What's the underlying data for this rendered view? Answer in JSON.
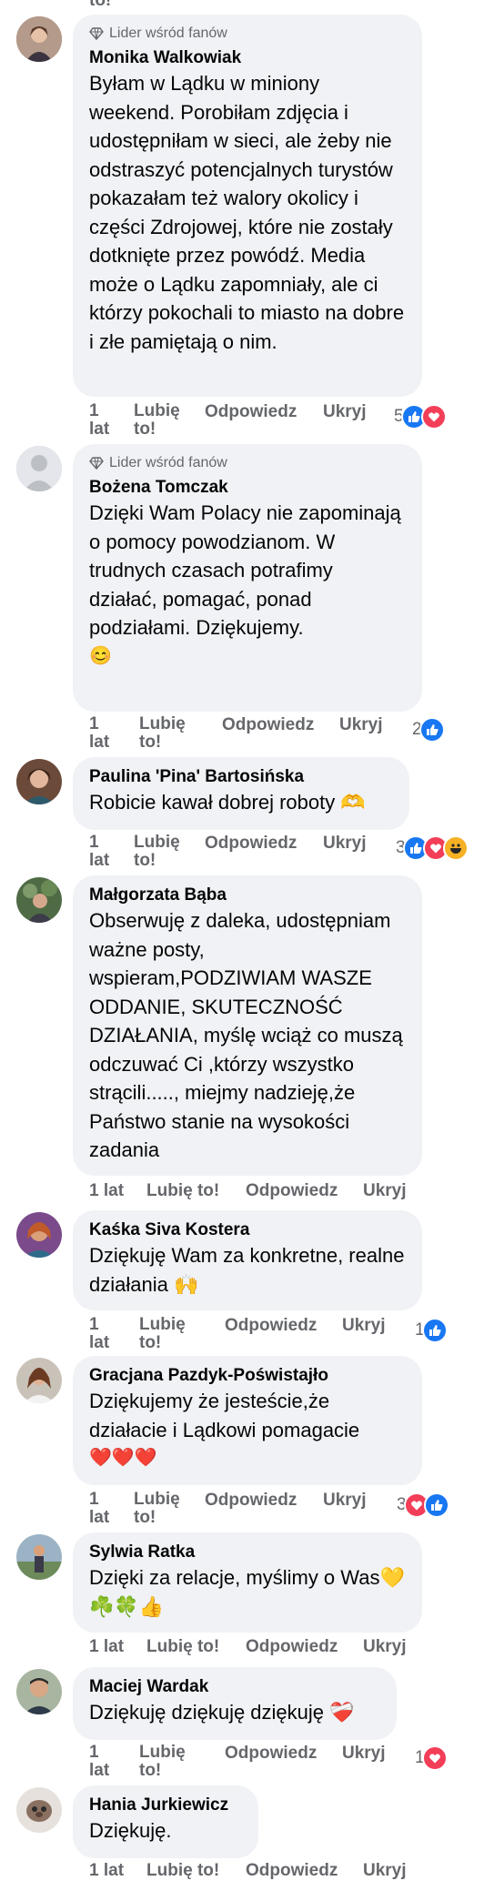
{
  "top_fragment": "to!",
  "comments": [
    {
      "badge": "Lider wśród fanów",
      "author": "Monika Walkowiak",
      "text": "Byłam w Lądku w miniony weekend. Porobiłam zdjęcia i udostępniłam w sieci, ale żeby nie odstraszyć potencjalnych turystów pokazałam też walory okolicy i części Zdrojowej, które nie zostały dotknięte przez powódź. Media może o Lądku zapomniały, ale ci którzy pokochali to miasto na dobre i złe pamiętają o nim.",
      "time": "1 lat",
      "like": "Lubię to!",
      "reply": "Odpowiedz",
      "hide": "Ukryj",
      "count": "5",
      "reactions": [
        "like",
        "love"
      ]
    },
    {
      "badge": "Lider wśród fanów",
      "author": "Bożena Tomczak",
      "text": "Dzięki Wam Polacy nie zapominają o pomocy powodzianom. W trudnych czasach potrafimy działać, pomagać, ponad podziałami. Dziękujemy.",
      "emoji": "😊",
      "time": "1 lat",
      "like": "Lubię to!",
      "reply": "Odpowiedz",
      "hide": "Ukryj",
      "count": "2",
      "reactions": [
        "like"
      ]
    },
    {
      "author": "Paulina 'Pina' Bartosińska",
      "text": "Robicie kawał dobrej roboty 🫶",
      "time": "1 lat",
      "like": "Lubię to!",
      "reply": "Odpowiedz",
      "hide": "Ukryj",
      "count": "3",
      "reactions": [
        "like",
        "love",
        "haha"
      ]
    },
    {
      "author": "Małgorzata Bąba",
      "text": "Obserwuję z daleka, udostępniam ważne posty, wspieram,PODZIWIAM WASZE ODDANIE, SKUTECZNOŚĆ DZIAŁANIA, myślę wciąż co muszą odczuwać Ci ,którzy wszystko strącili....., miejmy nadzieję,że Państwo stanie na wysokości zadania",
      "time": "1 lat",
      "like": "Lubię to!",
      "reply": "Odpowiedz",
      "hide": "Ukryj"
    },
    {
      "author": "Kaśka Siva Kostera",
      "text": "Dziękuję Wam za konkretne, realne działania 🙌",
      "time": "1 lat",
      "like": "Lubię to!",
      "reply": "Odpowiedz",
      "hide": "Ukryj",
      "count": "1",
      "reactions": [
        "like"
      ]
    },
    {
      "author": "Gracjana Pazdyk-Poświstajło",
      "text": "Dziękujemy że jesteście,że działacie i Lądkowi pomagacie",
      "emoji": "❤️❤️❤️",
      "time": "1 lat",
      "like": "Lubię to!",
      "reply": "Odpowiedz",
      "hide": "Ukryj",
      "count": "3",
      "reactions": [
        "love",
        "like"
      ]
    },
    {
      "author": "Sylwia Ratka",
      "text": "Dzięki za relacje, myślimy o Was💛☘️🍀👍",
      "time": "1 lat",
      "like": "Lubię to!",
      "reply": "Odpowiedz",
      "hide": "Ukryj"
    },
    {
      "author": "Maciej Wardak",
      "text": "Dziękuję dziękuję dziękuję ❤️‍🩹",
      "time": "1 lat",
      "like": "Lubię to!",
      "reply": "Odpowiedz",
      "hide": "Ukryj",
      "count": "1",
      "reactions": [
        "love"
      ]
    },
    {
      "author": "Hania Jurkiewicz",
      "text": "Dziękuję.",
      "time": "1 lat",
      "like": "Lubię to!",
      "reply": "Odpowiedz",
      "hide": "Ukryj"
    }
  ]
}
